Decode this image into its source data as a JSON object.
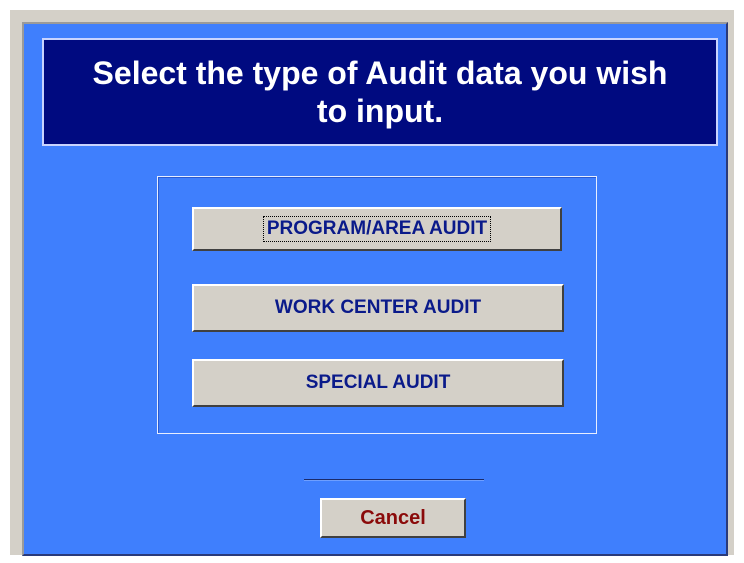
{
  "header": {
    "title": "Select the type of Audit data you wish to input."
  },
  "options": {
    "program_area": "PROGRAM/AREA AUDIT",
    "work_center": "WORK CENTER AUDIT",
    "special": "SPECIAL AUDIT"
  },
  "footer": {
    "cancel": "Cancel"
  },
  "colors": {
    "dialog_background": "#3f7ffd",
    "header_background": "#000a80",
    "button_face": "#d4d0c8",
    "option_text": "#0a1a8a",
    "cancel_text": "#8a0a0a"
  }
}
